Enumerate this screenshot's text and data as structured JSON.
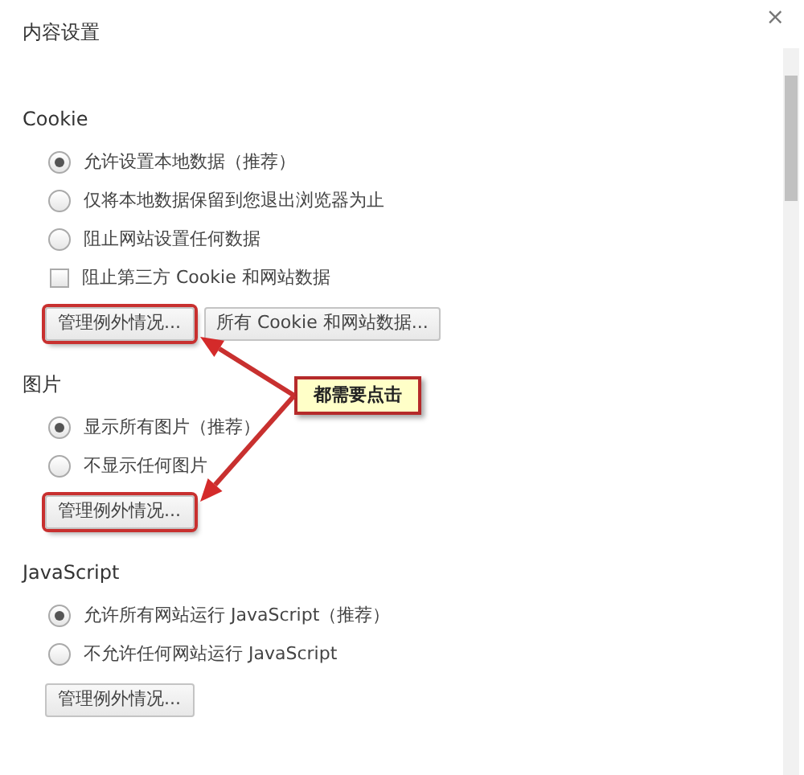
{
  "window": {
    "title": "内容设置",
    "close": "×"
  },
  "sections": [
    {
      "heading": "Cookie",
      "items": [
        {
          "kind": "radio",
          "label": "允许设置本地数据（推荐）",
          "selected": true
        },
        {
          "kind": "radio",
          "label": "仅将本地数据保留到您退出浏览器为止",
          "selected": false
        },
        {
          "kind": "radio",
          "label": "阻止网站设置任何数据",
          "selected": false
        },
        {
          "kind": "checkbox",
          "label": "阻止第三方 Cookie 和网站数据",
          "checked": false
        }
      ],
      "buttons": [
        {
          "label": "管理例外情况...",
          "highlighted": true
        },
        {
          "label": "所有 Cookie 和网站数据...",
          "highlighted": false
        }
      ]
    },
    {
      "heading": "图片",
      "items": [
        {
          "kind": "radio",
          "label": "显示所有图片（推荐）",
          "selected": true
        },
        {
          "kind": "radio",
          "label": "不显示任何图片",
          "selected": false
        }
      ],
      "buttons": [
        {
          "label": "管理例外情况...",
          "highlighted": true
        }
      ]
    },
    {
      "heading": "JavaScript",
      "items": [
        {
          "kind": "radio",
          "label": "允许所有网站运行 JavaScript（推荐）",
          "selected": true
        },
        {
          "kind": "radio",
          "label": "不允许任何网站运行 JavaScript",
          "selected": false
        }
      ],
      "buttons": [
        {
          "label": "管理例外情况...",
          "highlighted": false
        }
      ]
    }
  ],
  "callout": {
    "text": "都需要点击"
  }
}
